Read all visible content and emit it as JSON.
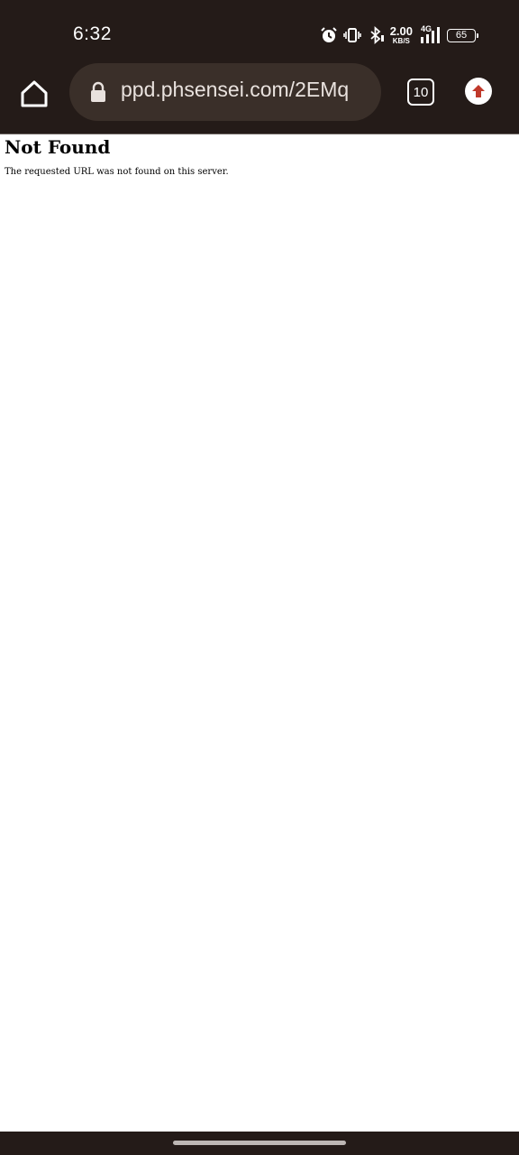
{
  "status_bar": {
    "time": "6:32",
    "net_speed_value": "2.00",
    "net_speed_unit": "KB/S",
    "network_type": "4G",
    "battery_level": "65",
    "icons": [
      "alarm-icon",
      "vibrate-icon",
      "bluetooth-icon",
      "signal-icon",
      "battery-icon"
    ]
  },
  "browser": {
    "url": "ppd.phsensei.com/2EMq",
    "tab_count": "10",
    "colors": {
      "toolbar_bg": "#241b18",
      "url_bar_bg": "#3a2f29",
      "extension_arrow": "#c0392b"
    }
  },
  "page": {
    "heading": "Not Found",
    "message": "The requested URL was not found on this server."
  }
}
